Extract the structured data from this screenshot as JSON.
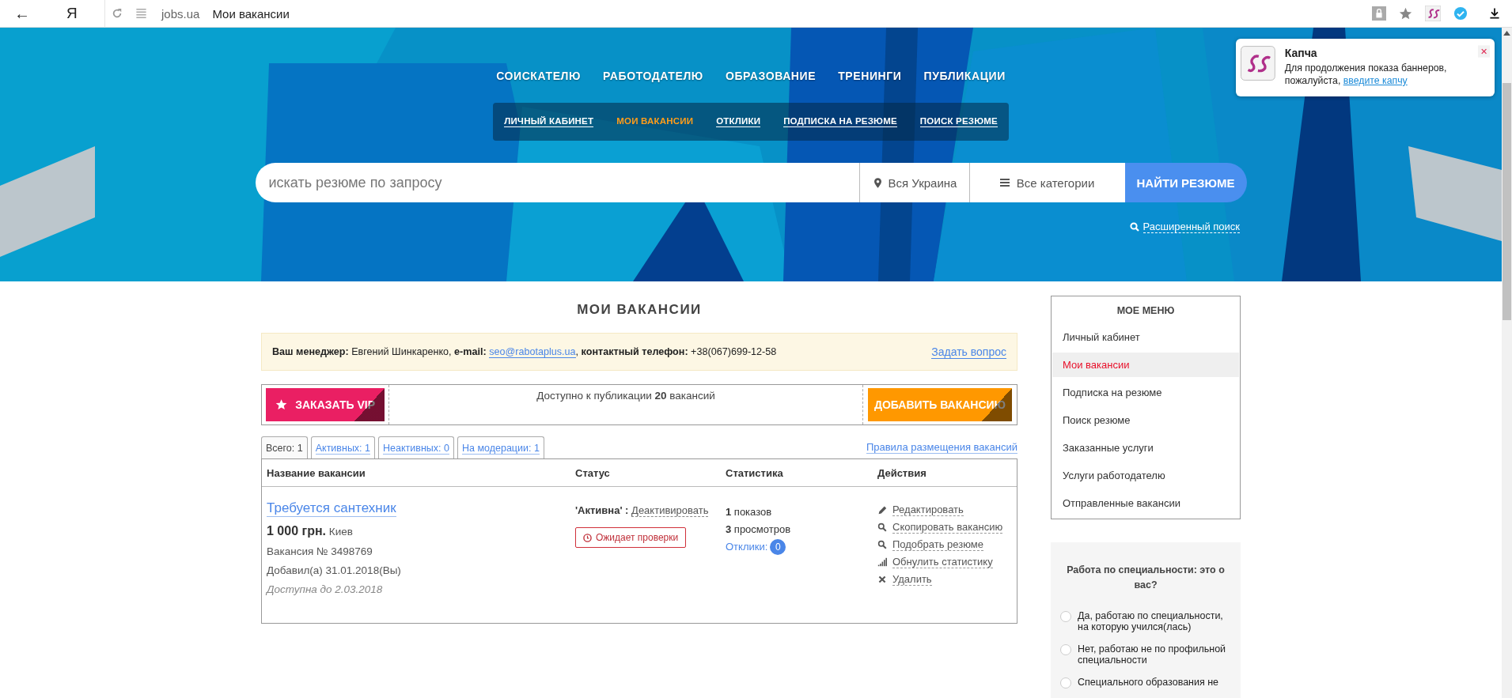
{
  "browser": {
    "back": "←",
    "yandex": "Я",
    "domain": "jobs.ua",
    "page_title": "Мои вакансии"
  },
  "nav": [
    "СОИСКАТЕЛЮ",
    "РАБОТОДАТЕЛЮ",
    "ОБРАЗОВАНИЕ",
    "ТРЕНИНГИ",
    "ПУБЛИКАЦИИ"
  ],
  "subnav": [
    {
      "label": "ЛИЧНЫЙ КАБИНЕТ",
      "selected": false
    },
    {
      "label": "МОИ ВАКАНСИИ",
      "selected": true
    },
    {
      "label": "ОТКЛИКИ",
      "selected": false
    },
    {
      "label": "ПОДПИСКА НА РЕЗЮМЕ",
      "selected": false
    },
    {
      "label": "ПОИСК РЕЗЮМЕ",
      "selected": false
    }
  ],
  "search": {
    "placeholder": "искать резюме по запросу",
    "region": "Вся Украина",
    "category": "Все категории",
    "button": "НАЙТИ РЕЗЮМЕ"
  },
  "advanced_search": "Расширенный поиск",
  "notification": {
    "title": "Капча",
    "text": "Для продолжения показа баннеров, пожалуйста,",
    "link": "введите капчу"
  },
  "heading": "МОИ ВАКАНСИИ",
  "manager": {
    "before": "**Ваш менеджер:** Евгений Шинкаренко, **e-mail:** ",
    "email": "seo@rabotaplus.ua",
    "after": ", **контактный телефон:** +38(067)699-12-58",
    "ask": "Задать вопрос"
  },
  "vip_button": "ЗАКАЗАТЬ VIP",
  "available": "Доступно к публикации **20** вакансий",
  "add_button": "ДОБАВИТЬ ВАКАНСИЮ",
  "tabs": [
    {
      "label": "Всего: 1",
      "selected": true
    },
    {
      "label": "Активных: 1",
      "selected": false
    },
    {
      "label": "Неактивных: 0",
      "selected": false
    },
    {
      "label": "На модерации: 1",
      "selected": false
    }
  ],
  "rules_link": "Правила размещения вакансий",
  "table": {
    "columns": [
      "Название вакансии",
      "Статус",
      "Статистика",
      "Действия"
    ],
    "rows": [
      {
        "title": "Требуется сантехник",
        "salary": "1 000 грн.",
        "city": "Киев",
        "number": "Вакансия № 3498769",
        "added": "Добавил(а) 31.01.2018(Вы)",
        "expires": "Доступна до 2.03.2018",
        "status": "'Активна' :",
        "status_action": "Деактивировать",
        "badge": "Ожидает проверки",
        "shows": "**1** показов",
        "views": "**3** просмотров",
        "responses_label": "Отклики:",
        "responses_count": "0",
        "actions": [
          {
            "kind": "edit",
            "label": "Редактировать"
          },
          {
            "kind": "search",
            "label": "Скопировать вакансию"
          },
          {
            "kind": "search",
            "label": "Подобрать резюме"
          },
          {
            "kind": "stats",
            "label": "Обнулить статистику"
          },
          {
            "kind": "delete",
            "label": "Удалить"
          }
        ]
      }
    ]
  },
  "sidebar": {
    "title": "МОЕ МЕНЮ",
    "items": [
      {
        "label": "Личный кабинет",
        "selected": false
      },
      {
        "label": "Мои вакансии",
        "selected": true
      },
      {
        "label": "Подписка на резюме",
        "selected": false
      },
      {
        "label": "Поиск резюме",
        "selected": false
      },
      {
        "label": "Заказанные услуги",
        "selected": false
      },
      {
        "label": "Услуги работодателю",
        "selected": false
      },
      {
        "label": "Отправленные вакансии",
        "selected": false
      }
    ]
  },
  "poll": {
    "question": "Работа по специальности: это о вас?",
    "options": [
      {
        "label": "Да, работаю по специальности, на которую учился(лась)",
        "selected": false
      },
      {
        "label": "Нет, работаю не по профильной специальности",
        "selected": false
      },
      {
        "label": "Специального образования не",
        "selected": false
      }
    ]
  }
}
